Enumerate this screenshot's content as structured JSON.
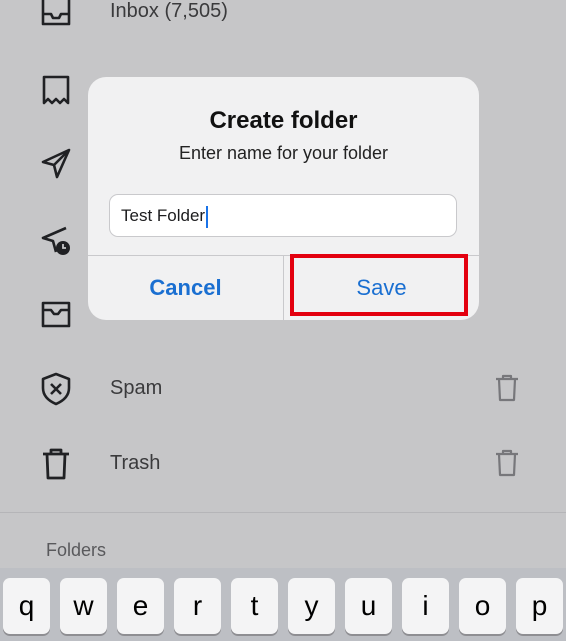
{
  "mailboxes": [
    {
      "label": "Inbox (7,505)",
      "icon": "inbox-icon"
    },
    {
      "label": "",
      "icon": "receipt-icon"
    },
    {
      "label": "",
      "icon": "send-icon"
    },
    {
      "label": "",
      "icon": "scheduled-send-icon"
    },
    {
      "label": "",
      "icon": "archive-icon"
    },
    {
      "label": "Spam",
      "icon": "spam-shield-icon"
    },
    {
      "label": "Trash",
      "icon": "trash-icon"
    }
  ],
  "sections": {
    "folders_label": "Folders"
  },
  "dialog": {
    "title": "Create folder",
    "message": "Enter name for your folder",
    "input_value": "Test Folder",
    "cancel_label": "Cancel",
    "save_label": "Save"
  },
  "keyboard": {
    "keys": [
      "q",
      "w",
      "e",
      "r",
      "t",
      "y",
      "u",
      "i",
      "o",
      "p"
    ]
  },
  "colors": {
    "accent": "#1a6fd1",
    "highlight": "#e3000f",
    "dim_background": "#c6c6c8"
  }
}
